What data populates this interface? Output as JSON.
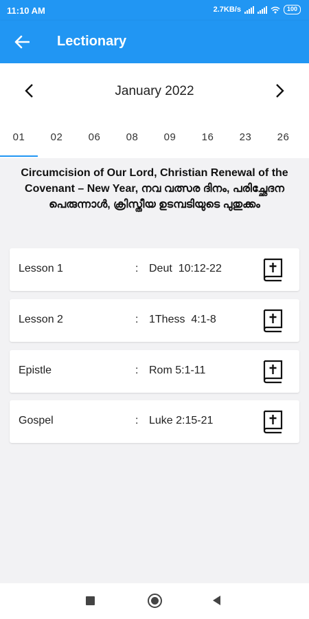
{
  "status_bar": {
    "time": "11:10 AM",
    "network_speed": "2.7KB/s",
    "battery": "100"
  },
  "app_bar": {
    "title": "Lectionary",
    "back_icon": "arrow-left-icon"
  },
  "month_nav": {
    "label": "January 2022",
    "prev_icon": "chevron-left-icon",
    "next_icon": "chevron-right-icon"
  },
  "day_tabs": [
    {
      "label": "01",
      "active": true
    },
    {
      "label": "02",
      "active": false
    },
    {
      "label": "06",
      "active": false
    },
    {
      "label": "08",
      "active": false
    },
    {
      "label": "09",
      "active": false
    },
    {
      "label": "16",
      "active": false
    },
    {
      "label": "23",
      "active": false
    },
    {
      "label": "26",
      "active": false
    }
  ],
  "feast": {
    "title": "Circumcision of Our Lord, Christian Renewal of the Covenant – New Year, നവ വത്സര ദിനം, പരിച്ഛേദന പെരുന്നാൾ, ക്രിസ്തീയ ഉടമ്പടിയുടെ പുതുക്കം"
  },
  "readings": [
    {
      "label": "Lesson 1",
      "separator": ":",
      "reference": "Deut  10:12-22",
      "icon": "bible-icon"
    },
    {
      "label": "Lesson 2",
      "separator": ":",
      "reference": "1Thess  4:1-8",
      "icon": "bible-icon"
    },
    {
      "label": "Epistle",
      "separator": ":",
      "reference": "Rom 5:1-11",
      "icon": "bible-icon"
    },
    {
      "label": "Gospel",
      "separator": ":",
      "reference": "Luke 2:15-21",
      "icon": "bible-icon"
    }
  ],
  "colors": {
    "primary": "#2196f3",
    "background": "#f2f2f4",
    "card": "#ffffff",
    "text": "#222222"
  }
}
